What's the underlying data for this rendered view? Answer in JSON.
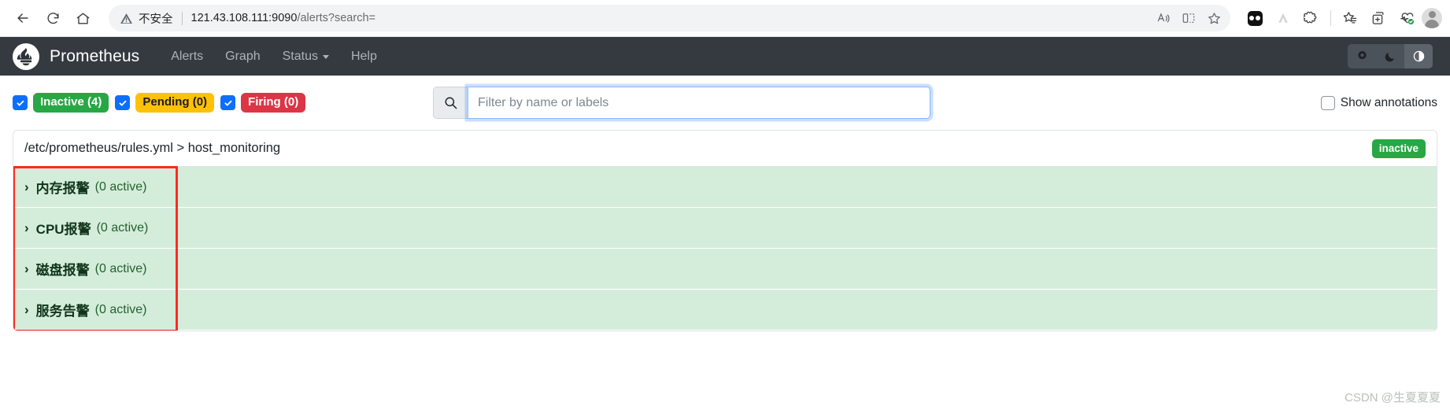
{
  "browser": {
    "back_label": "Back",
    "reload_label": "Refresh",
    "home_label": "Home",
    "security_label": "不安全",
    "url_host": "121.43.108.111:9090",
    "url_path": "/alerts?search=",
    "read_aloud_label": "Read aloud",
    "split_screen_label": "Split screen",
    "favorite_label": "Add this page to favorites",
    "extension1_label": "Extension",
    "extension2_label": "Extension",
    "extension3_label": "Extensions",
    "collections_label": "Collections",
    "add_collection_label": "Add to collection",
    "essentials_label": "Browser essentials",
    "profile_label": "Profile"
  },
  "navbar": {
    "brand": "Prometheus",
    "logo_name": "prometheus-logo",
    "links": [
      {
        "label": "Alerts"
      },
      {
        "label": "Graph"
      },
      {
        "label": "Status",
        "has_caret": true
      },
      {
        "label": "Help"
      }
    ],
    "theme_buttons": [
      {
        "name": "theme-light",
        "icon": "gear-icon",
        "active": false
      },
      {
        "name": "theme-dark",
        "icon": "moon-icon",
        "active": false
      },
      {
        "name": "theme-auto",
        "icon": "contrast-icon",
        "active": true
      }
    ]
  },
  "filters": {
    "states": [
      {
        "label": "Inactive (4)",
        "checked": true,
        "bg": "#28a745",
        "fg": "#ffffff"
      },
      {
        "label": "Pending (0)",
        "checked": true,
        "bg": "#ffc107",
        "fg": "#1c1c1c"
      },
      {
        "label": "Firing (0)",
        "checked": true,
        "bg": "#dc3545",
        "fg": "#ffffff"
      }
    ],
    "search_placeholder": "Filter by name or labels",
    "search_value": "",
    "search_icon": "search-icon",
    "show_annotations_label": "Show annotations",
    "show_annotations_checked": false
  },
  "group": {
    "breadcrumb": "/etc/prometheus/rules.yml > host_monitoring",
    "status_badge": "inactive",
    "rules": [
      {
        "name": "内存报警",
        "count": "(0 active)"
      },
      {
        "name": "CPU报警",
        "count": "(0 active)"
      },
      {
        "name": "磁盘报警",
        "count": "(0 active)"
      },
      {
        "name": "服务告警",
        "count": "(0 active)"
      }
    ]
  },
  "watermark": "CSDN @生夏夏夏",
  "colors": {
    "navbar_bg": "#343a40",
    "rule_row_bg": "#d4edda",
    "annotation_red": "#ff2a23",
    "focus_blue": "#86b7fe"
  }
}
